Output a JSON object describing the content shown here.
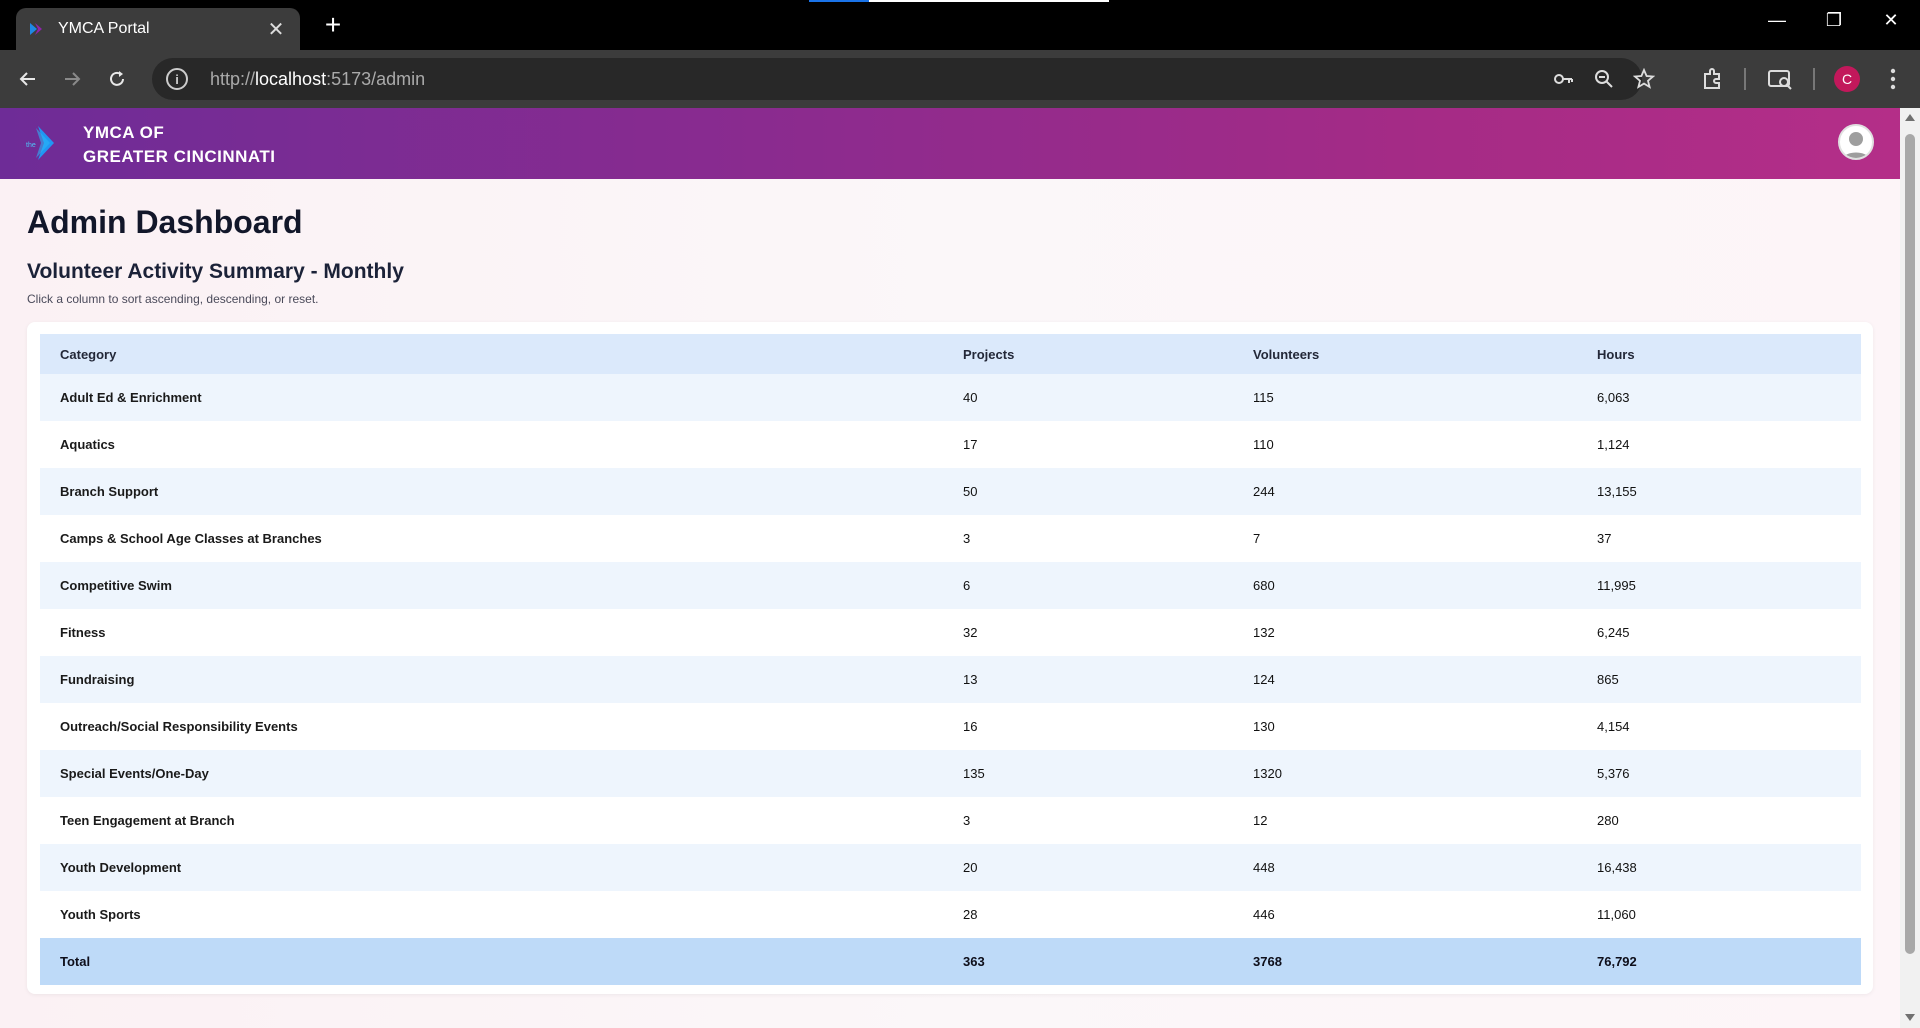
{
  "browser": {
    "tab_title": "YMCA Portal",
    "url_scheme": "http://",
    "url_host": "localhost",
    "url_path": ":5173/admin",
    "profile_initial": "C"
  },
  "header": {
    "brand_line1": "YMCA OF",
    "brand_line2": "GREATER CINCINNATI",
    "logo_small_text": "the"
  },
  "page": {
    "title": "Admin Dashboard",
    "section_title": "Volunteer Activity Summary - Monthly",
    "section_hint": "Click a column to sort ascending, descending, or reset."
  },
  "table": {
    "columns": [
      "Category",
      "Projects",
      "Volunteers",
      "Hours"
    ],
    "rows": [
      [
        "Adult Ed & Enrichment",
        "40",
        "115",
        "6,063"
      ],
      [
        "Aquatics",
        "17",
        "110",
        "1,124"
      ],
      [
        "Branch Support",
        "50",
        "244",
        "13,155"
      ],
      [
        "Camps & School Age Classes at Branches",
        "3",
        "7",
        "37"
      ],
      [
        "Competitive Swim",
        "6",
        "680",
        "11,995"
      ],
      [
        "Fitness",
        "32",
        "132",
        "6,245"
      ],
      [
        "Fundraising",
        "13",
        "124",
        "865"
      ],
      [
        "Outreach/Social Responsibility Events",
        "16",
        "130",
        "4,154"
      ],
      [
        "Special Events/One-Day",
        "135",
        "1320",
        "5,376"
      ],
      [
        "Teen Engagement at Branch",
        "3",
        "12",
        "280"
      ],
      [
        "Youth Development",
        "20",
        "448",
        "16,438"
      ],
      [
        "Youth Sports",
        "28",
        "446",
        "11,060"
      ]
    ],
    "total": [
      "Total",
      "363",
      "3768",
      "76,792"
    ]
  },
  "colors": {
    "header_start": "#6e2c97",
    "header_end": "#b42e88",
    "table_header_bg": "#dbe9fb",
    "row_stripe_bg": "#eef5fd",
    "total_row_bg": "#bedaf8"
  }
}
